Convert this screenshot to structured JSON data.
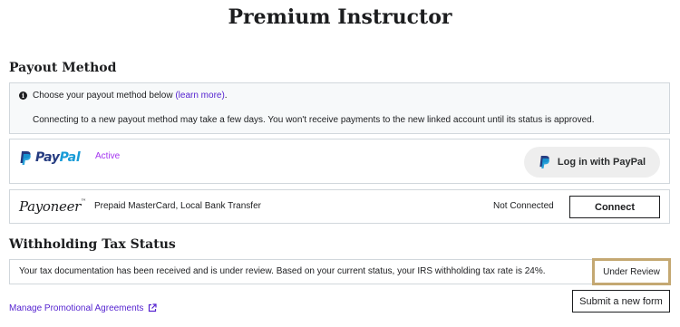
{
  "page_title": "Premium Instructor",
  "payout": {
    "heading": "Payout Method",
    "info": {
      "icon": "info-icon",
      "line1_prefix": "Choose your payout method below",
      "learn_more": "(learn more)",
      "line1_suffix": ".",
      "line2": "Connecting to a new payout method may take a few days. You won't receive payments to the new linked account until its status is approved."
    },
    "paypal": {
      "logo_pay": "Pay",
      "logo_pal": "Pal",
      "status": "Active",
      "button_label": "Log in with PayPal",
      "colors": {
        "navy": "#253b80",
        "blue": "#179bd7",
        "status": "#a435f0"
      }
    },
    "payoneer": {
      "logo": "Payoneer",
      "description": "Prepaid MasterCard, Local Bank Transfer",
      "status": "Not Connected",
      "button_label": "Connect"
    }
  },
  "tax": {
    "heading": "Withholding Tax Status",
    "message": "Your tax documentation has been received and is under review. Based on your current status, your IRS withholding tax rate is 24%.",
    "status": "Under Review",
    "status_border_color": "#c4a872",
    "submit_label": "Submit a new form"
  },
  "footer": {
    "manage_link": "Manage Promotional Agreements",
    "link_icon": "external-link-icon",
    "link_color": "#5624d0"
  }
}
